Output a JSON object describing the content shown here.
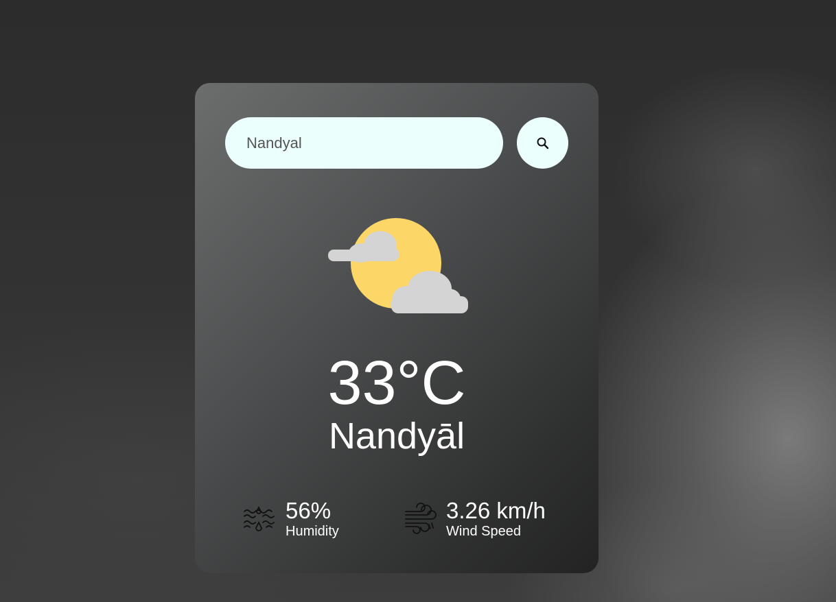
{
  "search": {
    "value": "Nandyal",
    "button_icon": "search-icon"
  },
  "weather": {
    "icon": "partly-cloudy-day-icon",
    "temperature": "33°C",
    "city": "Nandyāl"
  },
  "details": {
    "humidity": {
      "icon": "humidity-icon",
      "value": "56%",
      "label": "Humidity"
    },
    "wind": {
      "icon": "wind-icon",
      "value": "3.26 km/h",
      "label": "Wind Speed"
    }
  },
  "colors": {
    "input_bg": "#ebfffc",
    "sun": "#fcd767",
    "cloud": "#d4d4d4",
    "text": "#ffffff"
  }
}
